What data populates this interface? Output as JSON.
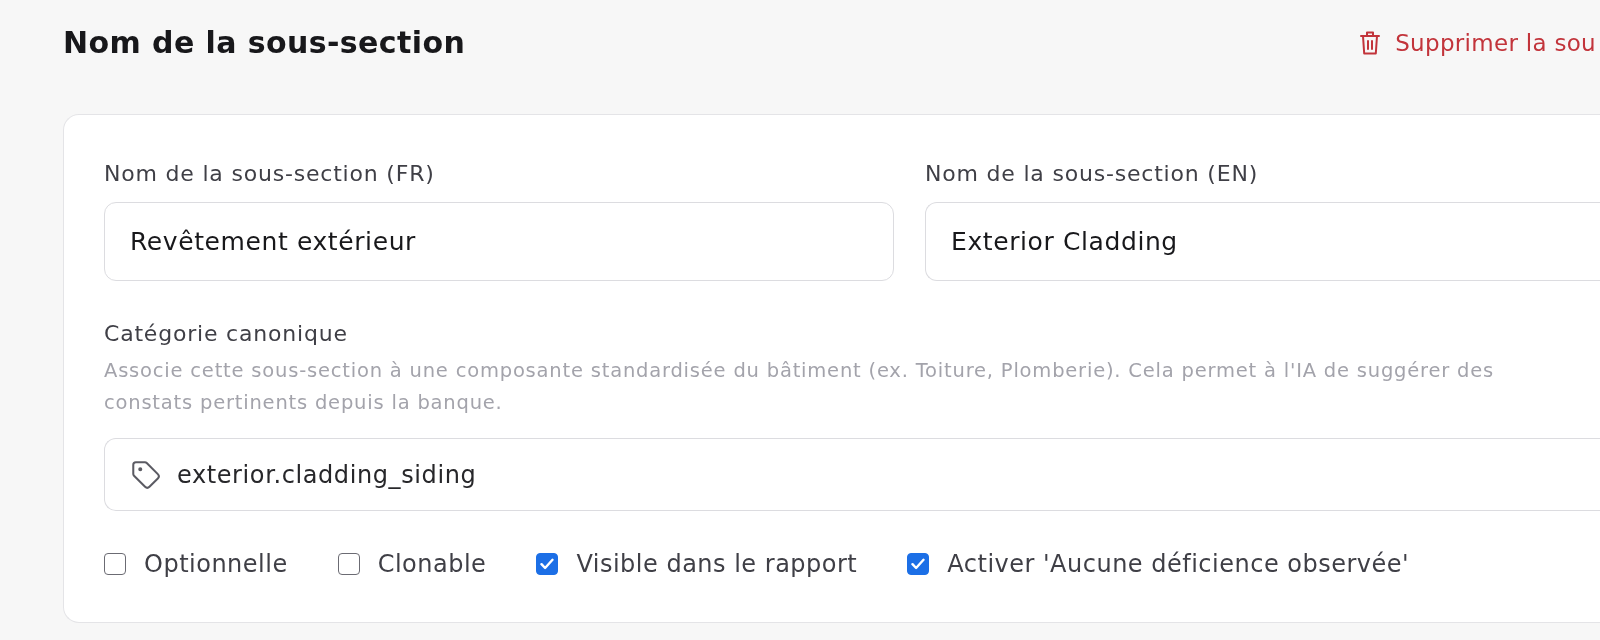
{
  "header": {
    "title": "Nom de la sous-section",
    "delete_action": "Supprimer la sou"
  },
  "card": {
    "name_fields": [
      {
        "label": "Nom de la sous-section (FR)",
        "value": "Revêtement extérieur"
      },
      {
        "label": "Nom de la sous-section (EN)",
        "value": "Exterior Cladding"
      }
    ],
    "category": {
      "label": "Catégorie canonique",
      "help_lines": [
        "Associe cette sous-section à une composante standardisée du bâtiment (ex. Toiture, Plomberie). Cela permet à l'IA de suggérer des",
        "constats pertinents depuis la banque."
      ],
      "value": "exterior.cladding_siding"
    },
    "options": [
      {
        "label": "Optionnelle",
        "checked": false
      },
      {
        "label": "Clonable",
        "checked": false
      },
      {
        "label": "Visible dans le rapport",
        "checked": true
      },
      {
        "label": "Activer 'Aucune déficience observée'",
        "checked": true
      }
    ]
  }
}
